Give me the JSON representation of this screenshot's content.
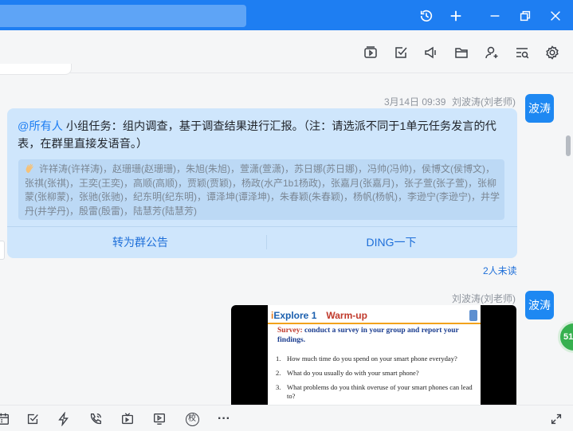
{
  "titlebar": {
    "icons": [
      "history-icon",
      "add-icon",
      "minimize-icon",
      "restore-icon",
      "close-icon"
    ]
  },
  "toolbar": {
    "icons": [
      "video-icon",
      "task-icon",
      "announcement-icon",
      "folder-icon",
      "add-member-icon",
      "search-history-icon",
      "settings-icon"
    ]
  },
  "messages": [
    {
      "timestamp": "3月14日 09:39",
      "sender": "刘波涛(刘老师)",
      "avatar_text": "波涛",
      "mention": "@所有人",
      "text": " 小组任务：组内调查，基于调查结果进行汇报。（注：请选派不同于1单元任务发言的代表，在群里直接发语音。）",
      "readers": "许祥涛(许祥涛)，赵珊珊(赵珊珊)，朱旭(朱旭)，萱潇(萱潇)，苏日娜(苏日娜)，冯帅(冯帅)，侯博文(侯博文)，张祺(张祺)，王奕(王奕)，高顺(高顺)，贾颖(贾颖)，杨政(水产1b1杨政)，张嘉月(张嘉月)，张子萱(张子萱)，张柳蒙(张柳蒙)，张驰(张驰)，纪东明(纪东明)，谭泽坤(谭泽坤)，朱春颖(朱春颖)，杨帆(杨帆)，李逊宁(李逊宁)，井学丹(井学丹)，殷雷(殷雷)，陆慧芳(陆慧芳)",
      "action_announce": "转为群公告",
      "action_ding": "DING一下",
      "unread": "2人未读"
    },
    {
      "sender": "刘波涛(刘老师)",
      "avatar_text": "波涛",
      "slide": {
        "brand": "Explore 1",
        "section": "Warm-up",
        "survey_label": "Survey:",
        "survey_text": " conduct a survey in your group and report your findings.",
        "questions": [
          {
            "n": "1.",
            "q": "How much time do you spend on your smart phone everyday?"
          },
          {
            "n": "2.",
            "q": "What do you usually do with your smart phone?"
          },
          {
            "n": "3.",
            "q": "What problems do you think overuse of your smart phones can lead to?"
          }
        ]
      }
    }
  ],
  "floating_badge": "51",
  "bottombar": {
    "icons": [
      "calendar-icon",
      "checkbox-icon",
      "lightning-icon",
      "phone-call-icon",
      "tv-icon",
      "live-icon",
      "school-icon",
      "more-icon",
      "expand-icon"
    ],
    "school_glyph": "校",
    "more_glyph": "···"
  },
  "colors": {
    "accent": "#1e7ef2",
    "bubble": "#cfe6fc",
    "badge": "#36b04f"
  }
}
